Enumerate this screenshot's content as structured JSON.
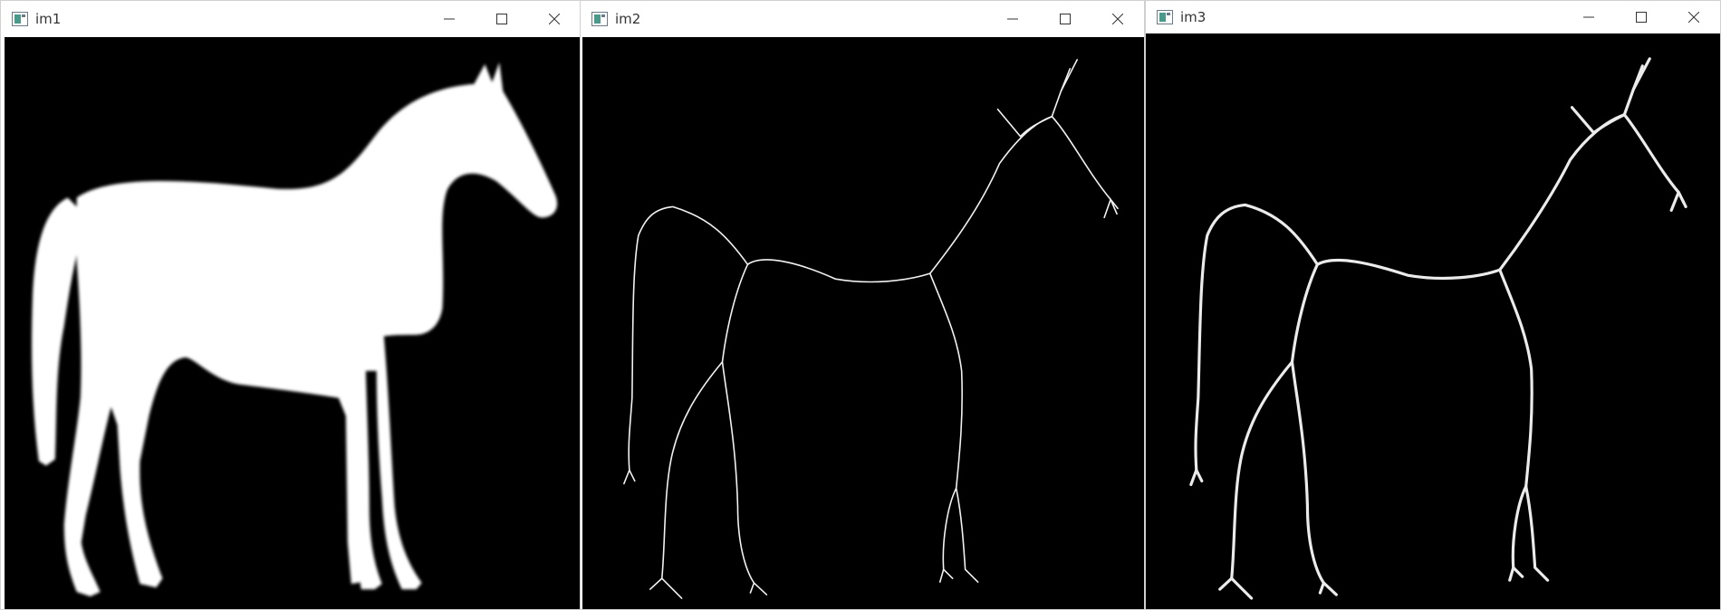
{
  "windows": [
    {
      "id": "win1",
      "title": "im1",
      "image": "horse-silhouette"
    },
    {
      "id": "win2",
      "title": "im2",
      "image": "horse-skeleton-thin"
    },
    {
      "id": "win3",
      "title": "im3",
      "image": "horse-skeleton-thick"
    }
  ],
  "controls": {
    "minimize_icon": "minimize-icon",
    "maximize_icon": "maximize-icon",
    "close_icon": "close-icon"
  },
  "colors": {
    "titlebar": "#ffffff",
    "image_background": "#000000",
    "foreground": "#ffffff",
    "icon_accent": "#4a9a8c"
  }
}
